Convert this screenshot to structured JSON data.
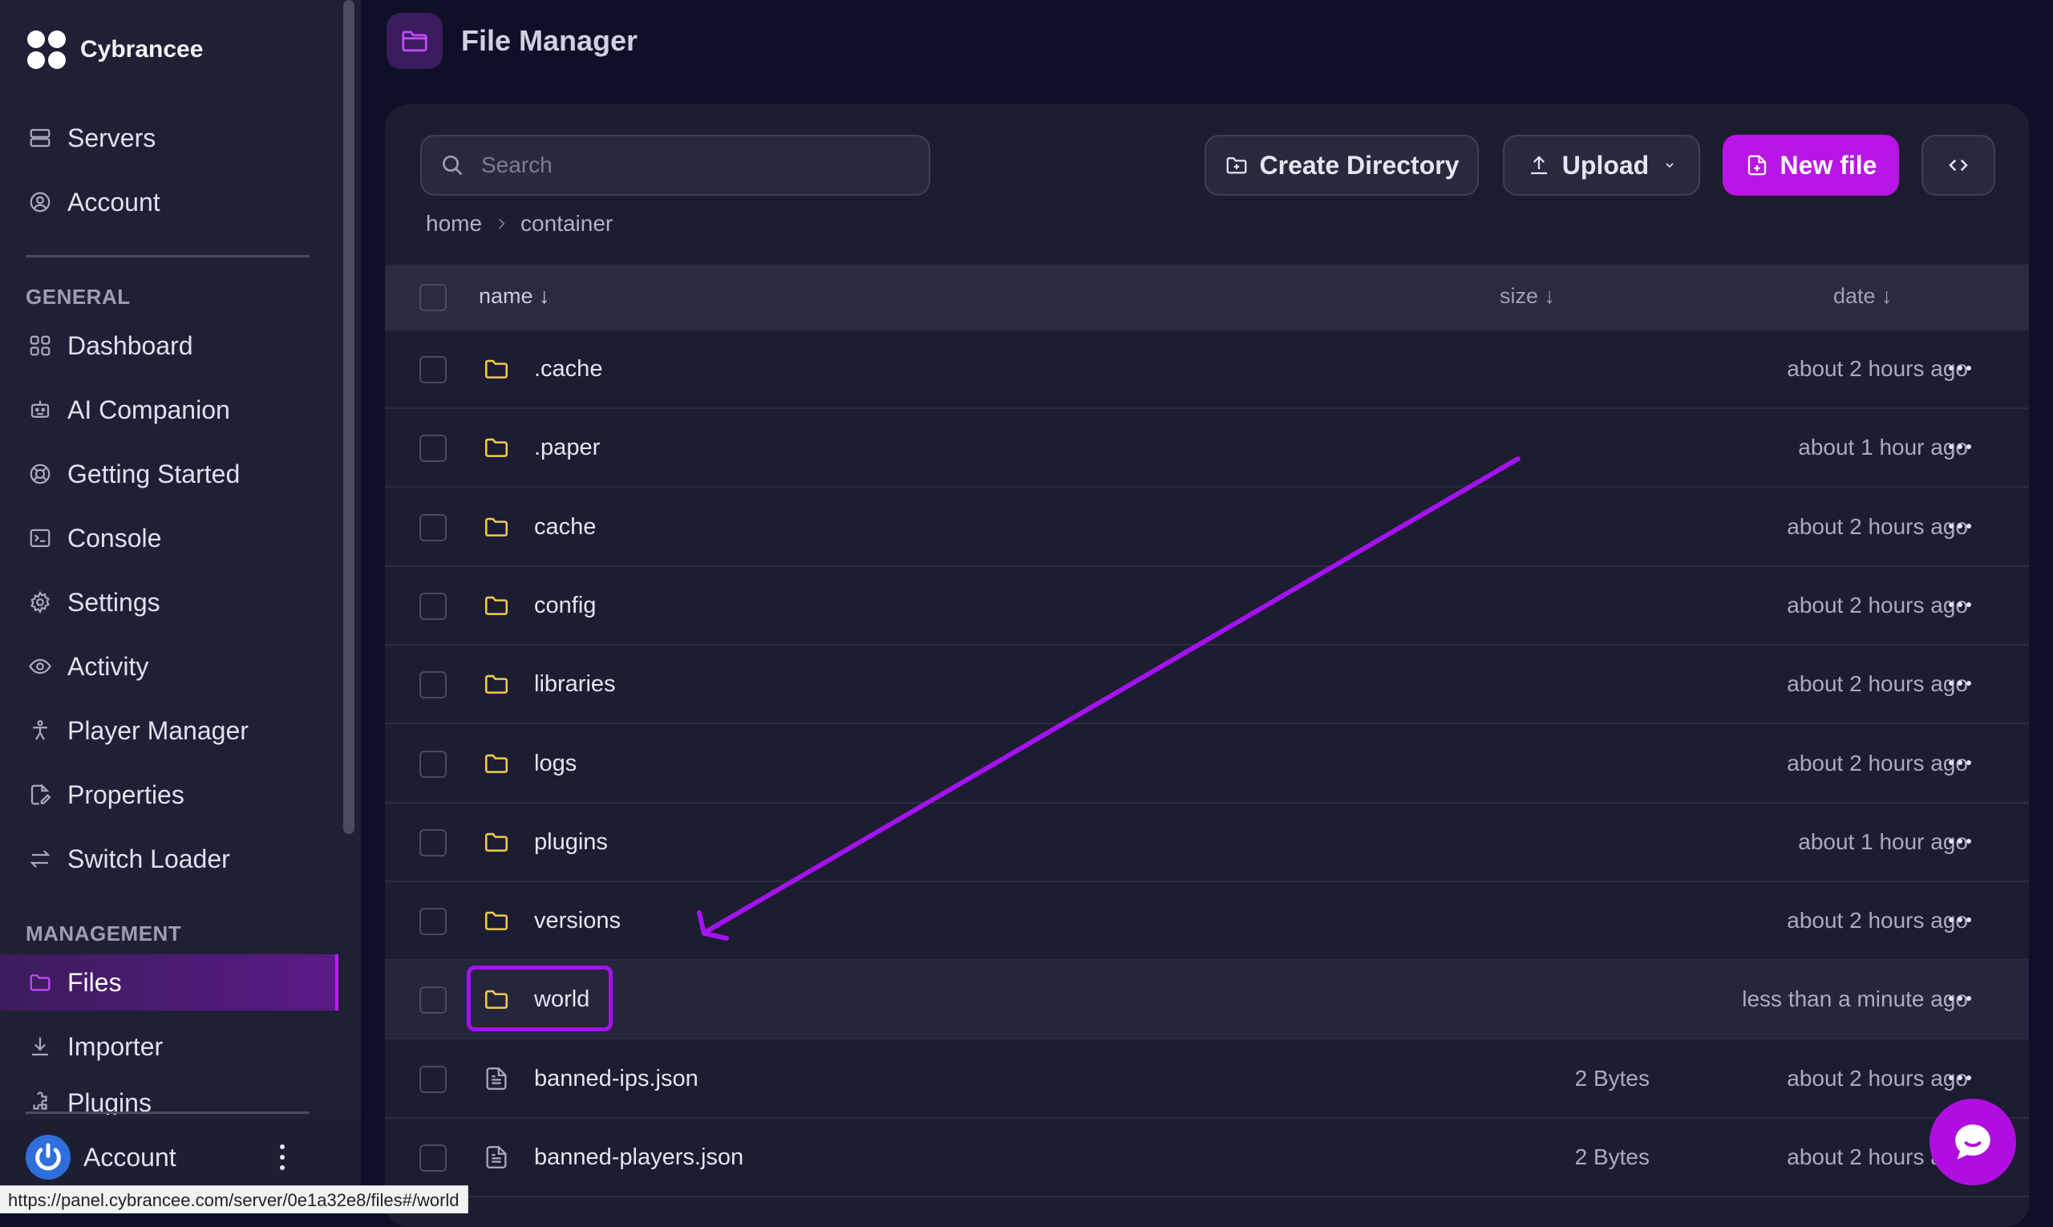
{
  "brand": {
    "name": "Cybrancee"
  },
  "sidebar": {
    "top_items": [
      {
        "label": "Servers",
        "icon": "servers-icon"
      },
      {
        "label": "Account",
        "icon": "account-icon"
      }
    ],
    "general_title": "GENERAL",
    "general_items": [
      {
        "label": "Dashboard",
        "icon": "dashboard-icon"
      },
      {
        "label": "AI Companion",
        "icon": "robot-icon"
      },
      {
        "label": "Getting Started",
        "icon": "lifebuoy-icon"
      },
      {
        "label": "Console",
        "icon": "terminal-icon"
      },
      {
        "label": "Settings",
        "icon": "gear-icon"
      },
      {
        "label": "Activity",
        "icon": "eye-icon"
      },
      {
        "label": "Player Manager",
        "icon": "person-icon"
      },
      {
        "label": "Properties",
        "icon": "edit-document-icon"
      },
      {
        "label": "Switch Loader",
        "icon": "switch-arrows-icon"
      }
    ],
    "management_title": "MANAGEMENT",
    "management_items": [
      {
        "label": "Files",
        "icon": "folder-icon",
        "active": true
      },
      {
        "label": "Importer",
        "icon": "download-icon"
      },
      {
        "label": "Plugins",
        "icon": "puzzle-icon"
      }
    ],
    "account": {
      "label": "Account"
    }
  },
  "header": {
    "title": "File Manager"
  },
  "toolbar": {
    "search_placeholder": "Search",
    "create_directory": "Create Directory",
    "upload": "Upload",
    "new_file": "New file"
  },
  "breadcrumb": [
    "home",
    "container"
  ],
  "table": {
    "columns": {
      "name": "name ↓",
      "size": "size ↓",
      "date": "date ↓"
    },
    "rows": [
      {
        "name": ".cache",
        "type": "folder",
        "size": "",
        "date": "about 2 hours ago"
      },
      {
        "name": ".paper",
        "type": "folder",
        "size": "",
        "date": "about 1 hour ago"
      },
      {
        "name": "cache",
        "type": "folder",
        "size": "",
        "date": "about 2 hours ago"
      },
      {
        "name": "config",
        "type": "folder",
        "size": "",
        "date": "about 2 hours ago"
      },
      {
        "name": "libraries",
        "type": "folder",
        "size": "",
        "date": "about 2 hours ago"
      },
      {
        "name": "logs",
        "type": "folder",
        "size": "",
        "date": "about 2 hours ago"
      },
      {
        "name": "plugins",
        "type": "folder",
        "size": "",
        "date": "about 1 hour ago"
      },
      {
        "name": "versions",
        "type": "folder",
        "size": "",
        "date": "about 2 hours ago"
      },
      {
        "name": "world",
        "type": "folder",
        "size": "",
        "date": "less than a minute ago",
        "highlighted": true
      },
      {
        "name": "banned-ips.json",
        "type": "file",
        "size": "2 Bytes",
        "date": "about 2 hours ago"
      },
      {
        "name": "banned-players.json",
        "type": "file",
        "size": "2 Bytes",
        "date": "about 2 hours ago"
      }
    ]
  },
  "status_url": "https://panel.cybrancee.com/server/0e1a32e8/files#/world",
  "colors": {
    "accent": "#b915e6",
    "folder": "#f2c94c",
    "annotation": "#a512f2"
  }
}
